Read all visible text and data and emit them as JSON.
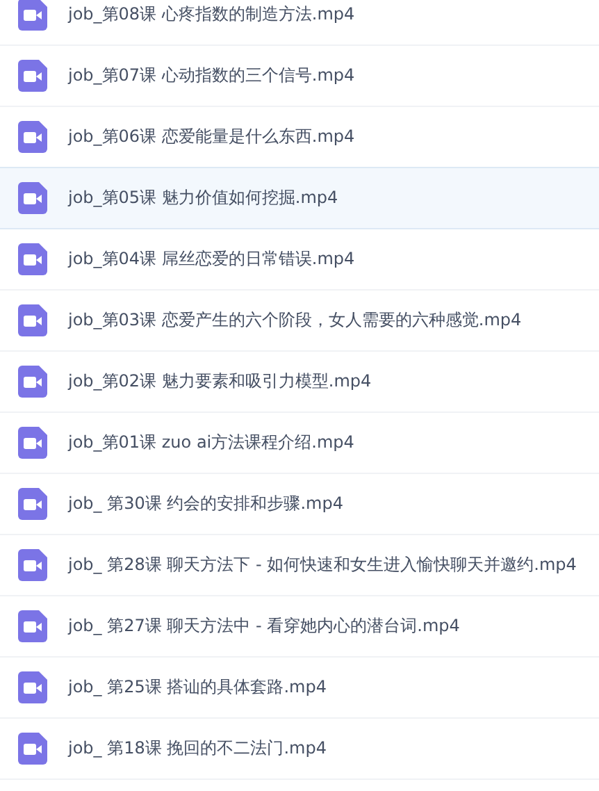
{
  "files": [
    {
      "name": "job_第08课 心疼指数的制造方法.mp4",
      "selected": false
    },
    {
      "name": "job_第07课 心动指数的三个信号.mp4",
      "selected": false
    },
    {
      "name": "job_第06课 恋爱能量是什么东西.mp4",
      "selected": false
    },
    {
      "name": "job_第05课 魅力价值如何挖掘.mp4",
      "selected": true
    },
    {
      "name": "job_第04课 屌丝恋爱的日常错误.mp4",
      "selected": false
    },
    {
      "name": "job_第03课 恋爱产生的六个阶段，女人需要的六种感觉.mp4",
      "selected": false
    },
    {
      "name": "job_第02课 魅力要素和吸引力模型.mp4",
      "selected": false
    },
    {
      "name": "job_第01课 zuo ai方法课程介绍.mp4",
      "selected": false
    },
    {
      "name": "job_ 第30课 约会的安排和步骤.mp4",
      "selected": false
    },
    {
      "name": "job_ 第28课 聊天方法下 - 如何快速和女生进入愉快聊天并邀约.mp4",
      "selected": false
    },
    {
      "name": "job_ 第27课 聊天方法中 - 看穿她内心的潜台词.mp4",
      "selected": false
    },
    {
      "name": "job_ 第25课 搭讪的具体套路.mp4",
      "selected": false
    },
    {
      "name": "job_ 第18课 挽回的不二法门.mp4",
      "selected": false
    }
  ]
}
